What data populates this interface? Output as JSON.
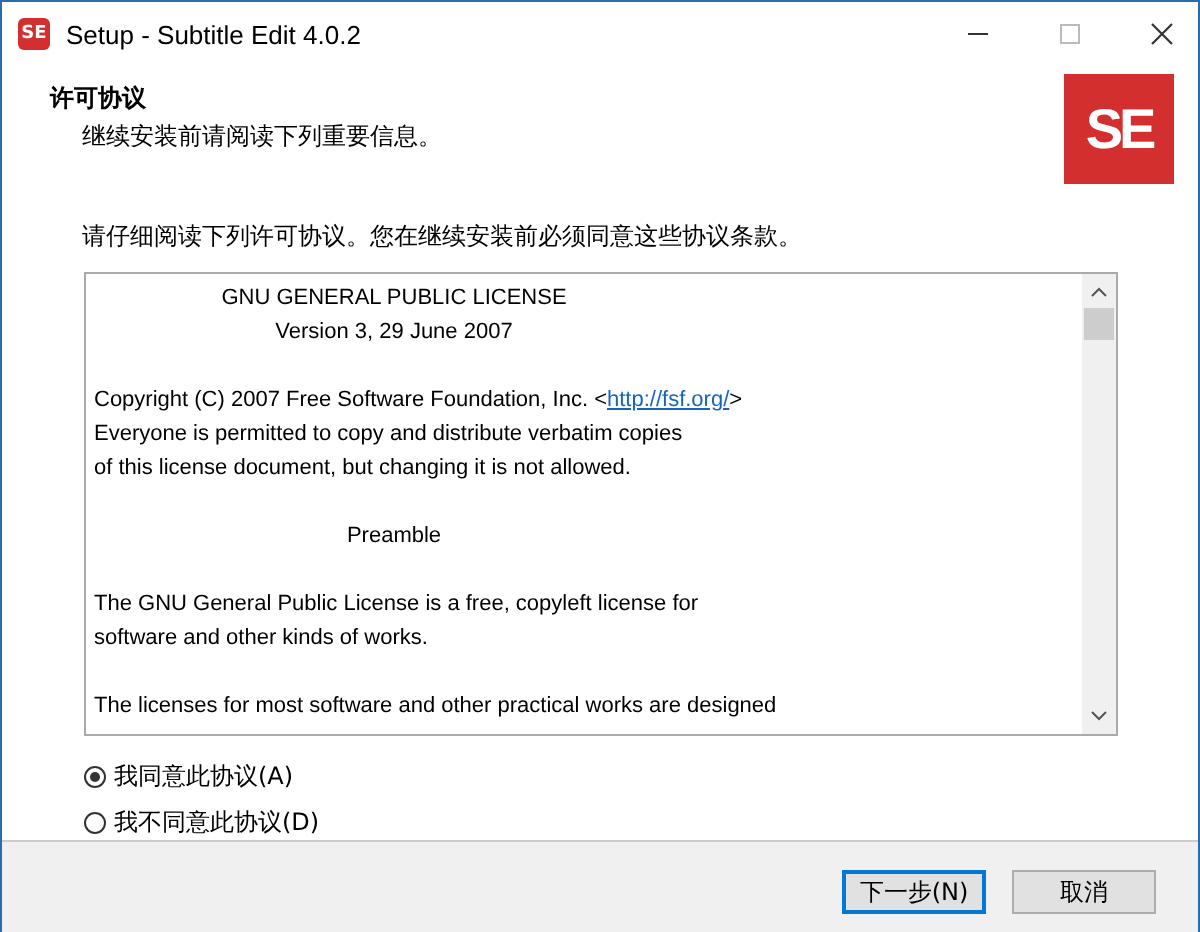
{
  "window": {
    "title": "Setup - Subtitle Edit 4.0.2",
    "logo": "SE"
  },
  "header": {
    "title": "许可协议",
    "subtitle": "继续安装前请阅读下列重要信息。",
    "logo": "SE"
  },
  "instruction": "请仔细阅读下列许可协议。您在继续安装前必须同意这些协议条款。",
  "license": {
    "paragraphs": [
      {
        "kind": "heading",
        "lines": [
          {
            "text": "GNU GENERAL PUBLIC LICENSE"
          },
          {
            "text": "Version 3, 29 June 2007"
          }
        ]
      },
      {
        "kind": "body",
        "lines": [
          {
            "text": "Copyright (C) 2007 Free Software Foundation, Inc. <",
            "link": "http://fsf.org/",
            "after": ">"
          },
          {
            "text": "Everyone is permitted to copy and distribute verbatim copies"
          },
          {
            "text": "of this license document, but changing it is not allowed."
          }
        ]
      },
      {
        "kind": "heading",
        "lines": [
          {
            "text": "Preamble"
          }
        ]
      },
      {
        "kind": "body",
        "lines": [
          {
            "text": " The GNU General Public License is a free, copyleft license for"
          },
          {
            "text": "software and other kinds of works."
          }
        ]
      },
      {
        "kind": "body",
        "lines": [
          {
            "text": " The licenses for most software and other practical works are designed"
          }
        ]
      }
    ]
  },
  "options": [
    {
      "label": "我同意此协议(A)",
      "selected": true
    },
    {
      "label": "我不同意此协议(D)",
      "selected": false
    }
  ],
  "buttons": [
    {
      "label": "下一步(N)",
      "default": true
    },
    {
      "label": "取消",
      "default": false
    }
  ]
}
